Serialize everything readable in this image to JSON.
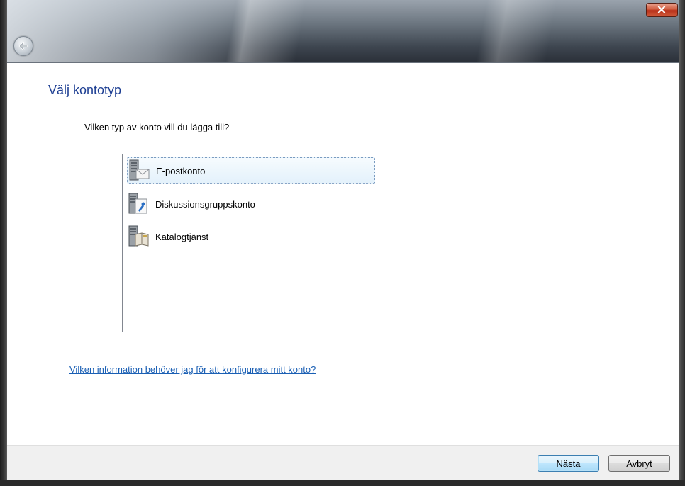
{
  "window": {
    "back_icon": "back-arrow-icon",
    "close_icon": "close-x-icon"
  },
  "page": {
    "title": "Välj kontotyp",
    "question": "Vilken typ av konto vill du lägga till?",
    "help_link": "Vilken information behöver jag för att konfigurera mitt konto?"
  },
  "account_types": [
    {
      "label": "E-postkonto",
      "icon": "email-server-icon",
      "selected": true
    },
    {
      "label": "Diskussionsgruppskonto",
      "icon": "newsgroup-server-icon",
      "selected": false
    },
    {
      "label": "Katalogtjänst",
      "icon": "directory-server-icon",
      "selected": false
    }
  ],
  "buttons": {
    "next": "Nästa",
    "cancel": "Avbryt"
  },
  "colors": {
    "title": "#1e3f93",
    "link": "#1a5fb4",
    "selection": "#e3f1fb",
    "close_button": "#c84a2c"
  }
}
